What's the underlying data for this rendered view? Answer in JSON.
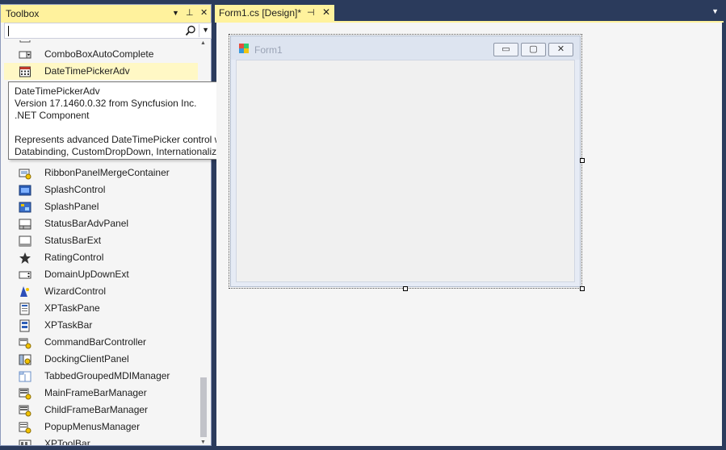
{
  "toolbox": {
    "title": "Toolbox",
    "dropdown_glyph": "▼",
    "pin_glyph": "⊥",
    "close_glyph": "✕",
    "search": {
      "value": ""
    },
    "partial_top_item": "",
    "items": [
      {
        "label": "ComboBoxAutoComplete",
        "icon": "combobox-icon"
      },
      {
        "label": "DateTimePickerAdv",
        "icon": "calendar-icon",
        "selected": true
      },
      {
        "label": "RibbonPanelMergeContainer",
        "icon": "ribbon-merge-icon"
      },
      {
        "label": "SplashControl",
        "icon": "splash-icon"
      },
      {
        "label": "SplashPanel",
        "icon": "splash-panel-icon"
      },
      {
        "label": "StatusBarAdvPanel",
        "icon": "statusbar-panel-icon"
      },
      {
        "label": "StatusBarExt",
        "icon": "statusbar-icon"
      },
      {
        "label": "RatingControl",
        "icon": "star-icon"
      },
      {
        "label": "DomainUpDownExt",
        "icon": "updown-icon"
      },
      {
        "label": "WizardControl",
        "icon": "wizard-icon"
      },
      {
        "label": "XPTaskPane",
        "icon": "taskpane-icon"
      },
      {
        "label": "XPTaskBar",
        "icon": "taskbar-icon"
      },
      {
        "label": "CommandBarController",
        "icon": "commandbar-icon"
      },
      {
        "label": "DockingClientPanel",
        "icon": "docking-icon"
      },
      {
        "label": "TabbedGroupedMDIManager",
        "icon": "tabbed-mdi-icon"
      },
      {
        "label": "MainFrameBarManager",
        "icon": "barmanager-icon"
      },
      {
        "label": "ChildFrameBarManager",
        "icon": "barmanager-icon"
      },
      {
        "label": "PopupMenusManager",
        "icon": "popupmenu-icon"
      },
      {
        "label": "XPToolBar",
        "icon": "toolbar-icon"
      }
    ]
  },
  "tooltip": {
    "line1": "DateTimePickerAdv",
    "line2": "Version 17.1460.0.32 from Syncfusion Inc.",
    "line3": ".NET Component",
    "line4": "Represents advanced DateTimePicker control with",
    "line5": "Databinding, CustomDropDown, Internationalization."
  },
  "document": {
    "tab_label": "Form1.cs [Design]*",
    "pin_glyph": "⊣",
    "close_glyph": "✕",
    "dropdown_glyph": "▼"
  },
  "form": {
    "title": "Form1",
    "minimize_glyph": "▭",
    "maximize_glyph": "▢",
    "close_glyph": "✕"
  },
  "colors": {
    "accent_yellow": "#fff29d",
    "chrome": "#2b3b5c",
    "selection": "#fff8c5"
  }
}
